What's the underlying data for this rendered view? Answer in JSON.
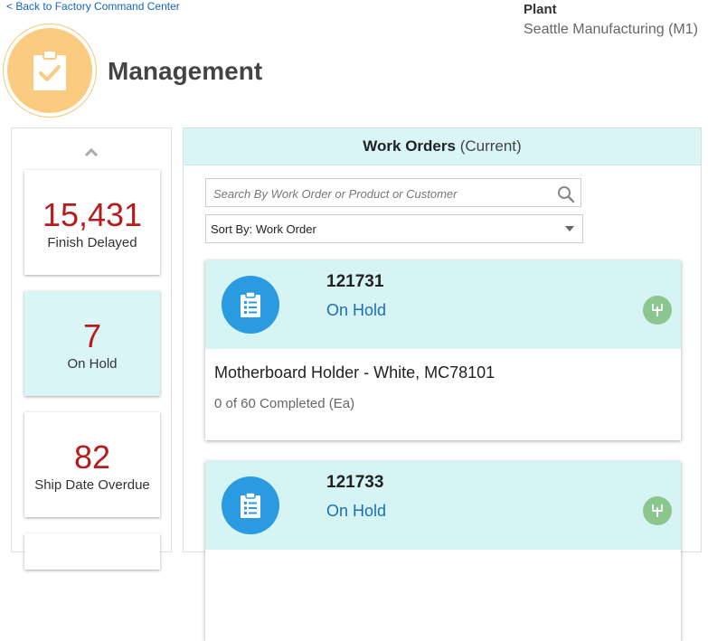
{
  "header": {
    "back_link": "< Back to Factory Command Center",
    "plant_label": "Plant",
    "plant_value": "Seattle Manufacturing (M1)",
    "title": "Management",
    "badge_icon": "clipboard-check-icon",
    "badge_color": "#fbcb7f"
  },
  "kpis": [
    {
      "value": "15,431",
      "label": "Finish Delayed",
      "active": false
    },
    {
      "value": "7",
      "label": "On Hold",
      "active": true
    },
    {
      "value": "82",
      "label": "Ship Date Overdue",
      "active": false
    }
  ],
  "panel": {
    "title": "Work Orders",
    "subtitle": "(Current)",
    "search_placeholder": "Search By Work Order or Product or Customer",
    "sort_label": "Sort By: Work Order"
  },
  "work_orders": [
    {
      "number": "121731",
      "status": "On Hold",
      "product": "Motherboard Holder - White, MC78101",
      "progress": "0 of 60 Completed (Ea)"
    },
    {
      "number": "121733",
      "status": "On Hold",
      "product": "",
      "progress": ""
    }
  ],
  "colors": {
    "accent_teal": "#d6f4f4",
    "kpi_value": "#b71c1c",
    "status_blue": "#1a6fb5",
    "icon_blue": "#2a9be0",
    "flag_green": "#8cc68f"
  }
}
